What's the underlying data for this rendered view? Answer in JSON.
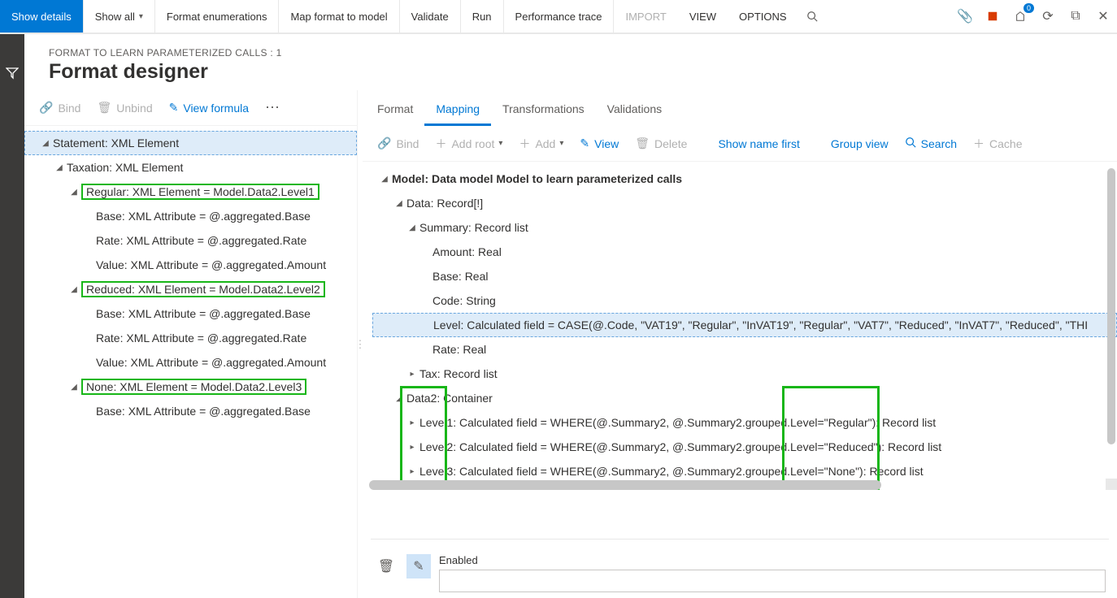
{
  "ribbon": {
    "show_details": "Show details",
    "show_all": "Show all",
    "format_enum": "Format enumerations",
    "map_format": "Map format to model",
    "validate": "Validate",
    "run": "Run",
    "perf_trace": "Performance trace",
    "import": "IMPORT",
    "view": "VIEW",
    "options": "OPTIONS",
    "badge_count": "0"
  },
  "header": {
    "breadcrumb": "FORMAT TO LEARN PARAMETERIZED CALLS : 1",
    "title": "Format designer"
  },
  "left_tools": {
    "bind": "Bind",
    "unbind": "Unbind",
    "view_formula": "View formula"
  },
  "left_tree": {
    "n0": "Statement: XML Element",
    "n1": "Taxation: XML Element",
    "n2": "Regular: XML Element = Model.Data2.Level1",
    "n3": "Base: XML Attribute = @.aggregated.Base",
    "n4": "Rate: XML Attribute = @.aggregated.Rate",
    "n5": "Value: XML Attribute = @.aggregated.Amount",
    "n6": "Reduced: XML Element = Model.Data2.Level2",
    "n7": "Base: XML Attribute = @.aggregated.Base",
    "n8": "Rate: XML Attribute = @.aggregated.Rate",
    "n9": "Value: XML Attribute = @.aggregated.Amount",
    "n10": "None: XML Element = Model.Data2.Level3",
    "n11": "Base: XML Attribute = @.aggregated.Base"
  },
  "tabs": {
    "format": "Format",
    "mapping": "Mapping",
    "transformations": "Transformations",
    "validations": "Validations"
  },
  "right_tools": {
    "bind": "Bind",
    "add_root": "Add root",
    "add": "Add",
    "view": "View",
    "delete": "Delete",
    "show_name": "Show name first",
    "group": "Group view",
    "search": "Search",
    "cache": "Cache"
  },
  "right_tree": {
    "m0": "Model: Data model Model to learn parameterized calls",
    "m1": "Data: Record[!]",
    "m2": "Summary: Record list",
    "m3": "Amount: Real",
    "m4": "Base: Real",
    "m5": "Code: String",
    "m6": "Level: Calculated field = CASE(@.Code, \"VAT19\", \"Regular\", \"InVAT19\", \"Regular\", \"VAT7\", \"Reduced\", \"InVAT7\", \"Reduced\", \"THI",
    "m7": "Rate: Real",
    "m8": "Tax: Record list",
    "m9": "Data2: Container",
    "m10": "Level1: Calculated field = WHERE(@.Summary2, @.Summary2.grouped.Level=\"Regular\"): Record list",
    "m11": "Level2: Calculated field = WHERE(@.Summary2, @.Summary2.grouped.Level=\"Reduced\"): Record list",
    "m12": "Level3: Calculated field = WHERE(@.Summary2, @.Summary2.grouped.Level=\"None\"): Record list"
  },
  "footer": {
    "enabled": "Enabled"
  }
}
